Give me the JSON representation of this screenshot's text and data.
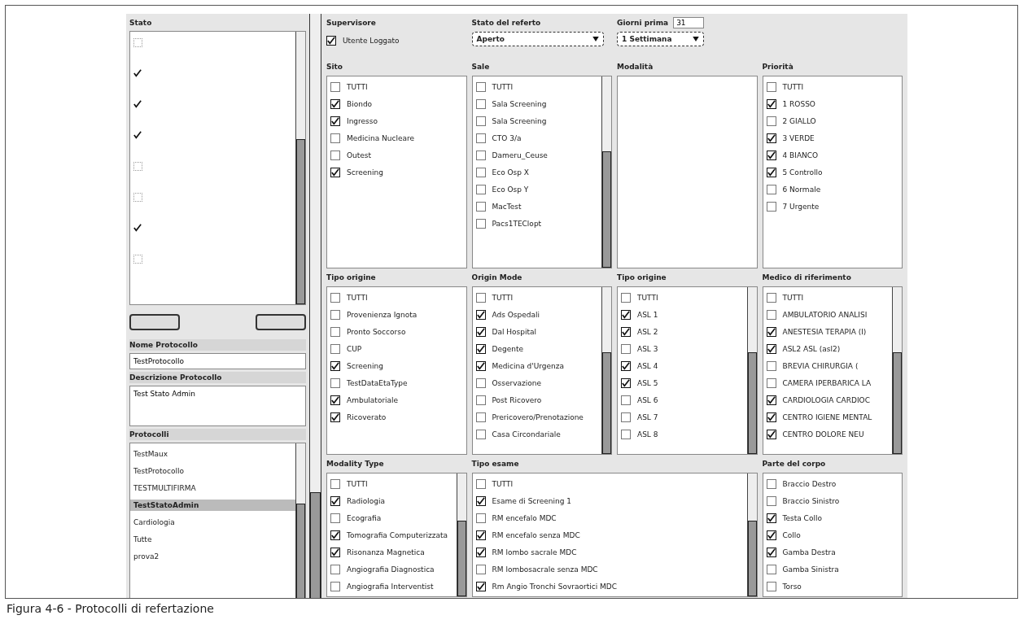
{
  "stato": {
    "title": "Stato",
    "items": [
      {
        "checked": false
      },
      {
        "checked": true
      },
      {
        "checked": true
      },
      {
        "checked": true
      },
      {
        "checked": false
      },
      {
        "checked": false
      },
      {
        "checked": true
      },
      {
        "checked": false
      }
    ]
  },
  "nome_protocollo": {
    "label": "Nome Protocollo",
    "value": "TestProtocollo"
  },
  "descrizione_protocollo": {
    "label": "Descrizione Protocollo",
    "value": "Test Stato Admin"
  },
  "protocolli": {
    "title": "Protocolli",
    "items": [
      {
        "label": "TestMaux",
        "selected": false
      },
      {
        "label": "TestProtocollo",
        "selected": false
      },
      {
        "label": "TESTMULTIFIRMA",
        "selected": false
      },
      {
        "label": "TestStatoAdmin",
        "selected": true
      },
      {
        "label": "Cardiologia",
        "selected": false
      },
      {
        "label": "Tutte",
        "selected": false
      },
      {
        "label": "prova2",
        "selected": false
      }
    ]
  },
  "supervisore": {
    "title": "Supervisore",
    "label": "Utente Loggato",
    "checked": true
  },
  "stato_referto": {
    "title": "Stato del referto",
    "value": "Aperto"
  },
  "giorni_prima": {
    "title": "Giorni prima",
    "value": "31",
    "period": "1 Settimana"
  },
  "lists": [
    {
      "title": "Sito",
      "scrollable": false,
      "items": [
        {
          "label": "TUTTI",
          "checked": false
        },
        {
          "label": "Biondo",
          "checked": true
        },
        {
          "label": "Ingresso",
          "checked": true
        },
        {
          "label": "Medicina Nucleare",
          "checked": false
        },
        {
          "label": "Outest",
          "checked": false
        },
        {
          "label": "Screening",
          "checked": true
        }
      ]
    },
    {
      "title": "Sale",
      "scrollable": true,
      "items": [
        {
          "label": "TUTTI",
          "checked": false
        },
        {
          "label": "Sala Screening",
          "checked": false
        },
        {
          "label": "Sala Screening",
          "checked": false
        },
        {
          "label": "CTO 3/a",
          "checked": false
        },
        {
          "label": "Dameru_Ceuse",
          "checked": false
        },
        {
          "label": "Eco Osp X",
          "checked": false
        },
        {
          "label": "Eco Osp Y",
          "checked": false
        },
        {
          "label": "MacTest",
          "checked": false
        },
        {
          "label": "Pacs1TEClopt",
          "checked": false
        }
      ]
    },
    {
      "title": "Modalità",
      "scrollable": false
    },
    {
      "title": "Priorità",
      "scrollable": false,
      "items": [
        {
          "label": "TUTTI",
          "checked": false
        },
        {
          "label": "1 ROSSO",
          "checked": true
        },
        {
          "label": "2 GIALLO",
          "checked": false
        },
        {
          "label": "3 VERDE",
          "checked": true
        },
        {
          "label": "4 BIANCO",
          "checked": true
        },
        {
          "label": "5 Controllo",
          "checked": true
        },
        {
          "label": "6 Normale",
          "checked": false
        },
        {
          "label": "7 Urgente",
          "checked": false
        }
      ]
    },
    {
      "title": "Tipo origine",
      "scrollable": false,
      "items": [
        {
          "label": "TUTTI",
          "checked": false
        },
        {
          "label": "Provenienza Ignota",
          "checked": false
        },
        {
          "label": "Pronto Soccorso",
          "checked": false
        },
        {
          "label": "CUP",
          "checked": false
        },
        {
          "label": "Screening",
          "checked": true
        },
        {
          "label": "TestDataEtaType",
          "checked": false
        },
        {
          "label": "Ambulatoriale",
          "checked": true
        },
        {
          "label": "Ricoverato",
          "checked": true
        }
      ]
    },
    {
      "title": "Origin Mode",
      "scrollable": true,
      "items": [
        {
          "label": "TUTTI",
          "checked": false
        },
        {
          "label": "Ads Ospedali",
          "checked": true
        },
        {
          "label": "Dal Hospital",
          "checked": true
        },
        {
          "label": "Degente",
          "checked": true
        },
        {
          "label": "Medicina d'Urgenza",
          "checked": true
        },
        {
          "label": "Osservazione",
          "checked": false
        },
        {
          "label": "Post Ricovero",
          "checked": false
        },
        {
          "label": "Prericovero/Prenotazione",
          "checked": false
        },
        {
          "label": "Casa Circondariale",
          "checked": false
        }
      ]
    },
    {
      "title": "Tipo origine",
      "scrollable": true,
      "items": [
        {
          "label": "TUTTI",
          "checked": false
        },
        {
          "label": "ASL 1",
          "checked": true
        },
        {
          "label": "ASL 2",
          "checked": true
        },
        {
          "label": "ASL 3",
          "checked": false
        },
        {
          "label": "ASL 4",
          "checked": true
        },
        {
          "label": "ASL 5",
          "checked": true
        },
        {
          "label": "ASL 6",
          "checked": false
        },
        {
          "label": "ASL 7",
          "checked": false
        },
        {
          "label": "ASL 8",
          "checked": false
        }
      ]
    },
    {
      "title": "Medico di riferimento",
      "scrollable": true,
      "items": [
        {
          "label": "TUTTI",
          "checked": false
        },
        {
          "label": "AMBULATORIO ANALISI",
          "checked": false
        },
        {
          "label": "ANESTESIA TERAPIA (I)",
          "checked": true
        },
        {
          "label": "ASL2 ASL (asl2)",
          "checked": true
        },
        {
          "label": "BREVIA CHIRURGIA (",
          "checked": false
        },
        {
          "label": "CAMERA IPERBARICA LA",
          "checked": false
        },
        {
          "label": "CARDIOLOGIA CARDIOC",
          "checked": true
        },
        {
          "label": "CENTRO IGIENE MENTAL",
          "checked": true
        },
        {
          "label": "CENTRO DOLORE NEU",
          "checked": true
        }
      ]
    },
    {
      "title": "Modality Type",
      "scrollable": true,
      "items": [
        {
          "label": "TUTTI",
          "checked": false
        },
        {
          "label": "Radiologia",
          "checked": true
        },
        {
          "label": "Ecografia",
          "checked": false
        },
        {
          "label": "Tomografia Computerizzata",
          "checked": true
        },
        {
          "label": "Risonanza Magnetica",
          "checked": true
        },
        {
          "label": "Angiografia Diagnostica",
          "checked": false
        },
        {
          "label": "Angiografia Interventist",
          "checked": false
        }
      ]
    },
    {
      "title": "Tipo esame",
      "scrollable": true,
      "items": [
        {
          "label": "TUTTI",
          "checked": false
        },
        {
          "label": "Esame di Screening 1",
          "checked": true
        },
        {
          "label": "RM encefalo MDC",
          "checked": false
        },
        {
          "label": "RM encefalo senza MDC",
          "checked": true
        },
        {
          "label": "RM lombo sacrale MDC",
          "checked": true
        },
        {
          "label": "RM lombosacrale senza MDC",
          "checked": false
        },
        {
          "label": "Rm Angio Tronchi Sovraortici MDC",
          "checked": true
        }
      ]
    },
    {
      "title": "Parte del corpo",
      "scrollable": false,
      "items": [
        {
          "label": "Braccio Destro",
          "checked": false
        },
        {
          "label": "Braccio Sinistro",
          "checked": false
        },
        {
          "label": "Testa Collo",
          "checked": true
        },
        {
          "label": "Collo",
          "checked": true
        },
        {
          "label": "Gamba Destra",
          "checked": true
        },
        {
          "label": "Gamba Sinistra",
          "checked": false
        },
        {
          "label": "Torso",
          "checked": false
        }
      ]
    }
  ],
  "caption": "Figura 4-6 - Protocolli di refertazione"
}
